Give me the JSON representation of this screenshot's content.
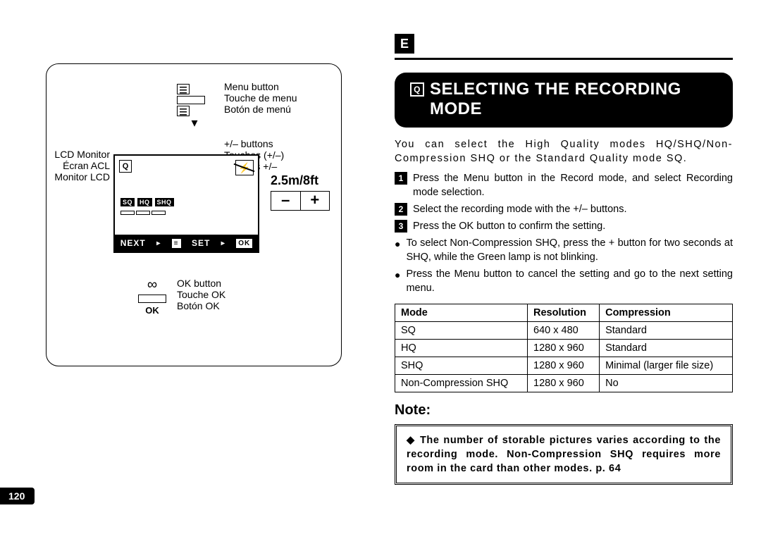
{
  "language_badge": "E",
  "heading": "SELECTING THE RECORDING MODE",
  "intro": "You can select the High Quality modes HQ/SHQ/Non-Compression SHQ or the Standard Quality mode SQ.",
  "steps": [
    "Press the Menu button in the Record mode, and select Recording mode selection.",
    "Select the recording mode with the +/– buttons.",
    "Press the OK button to confirm the setting."
  ],
  "bullets": [
    "To select Non-Compression SHQ, press the + button for two seconds at SHQ, while the Green lamp is not blinking.",
    "Press the Menu button to cancel the setting and go to the next setting menu."
  ],
  "table": {
    "headers": [
      "Mode",
      "Resolution",
      "Compression"
    ],
    "rows": [
      [
        "SQ",
        "640 x 480",
        "Standard"
      ],
      [
        "HQ",
        "1280 x 960",
        "Standard"
      ],
      [
        "SHQ",
        "1280 x 960",
        "Minimal (larger file size)"
      ],
      [
        "Non-Compression SHQ",
        "1280 x 960",
        "No"
      ]
    ]
  },
  "note_heading": "Note:",
  "note_text": "The number of storable pictures varies according to the recording mode. Non-Compression SHQ requires more room in the card than other modes. p. 64",
  "page_number": "120",
  "diagram": {
    "menu_button": {
      "en": "Menu button",
      "fr": "Touche de menu",
      "es": "Botón de menú"
    },
    "lcd_monitor": {
      "en": "LCD Monitor",
      "fr": "Écran ACL",
      "es": "Monitor LCD"
    },
    "pm_buttons": {
      "en": "+/– buttons",
      "fr": "Touches (+/–)",
      "es": "Botones +/–"
    },
    "ok_button": {
      "en": "OK button",
      "fr": "Touche OK",
      "es": "Botón OK"
    },
    "lcd": {
      "q": "Q",
      "modes": [
        "SQ",
        "HQ",
        "SHQ"
      ],
      "next": "NEXT",
      "set": "SET",
      "ok": "OK"
    },
    "distance": "2.5m/8ft",
    "minus": "–",
    "plus": "+",
    "ok_label": "OK"
  }
}
